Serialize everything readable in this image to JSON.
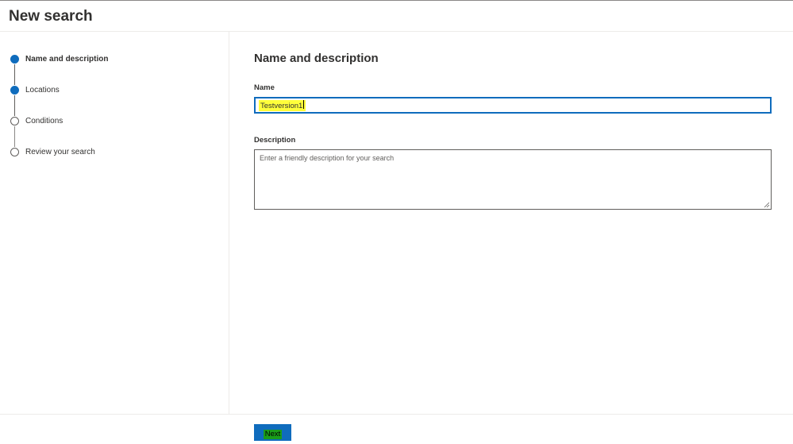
{
  "header": {
    "title": "New search"
  },
  "wizard": {
    "steps": [
      {
        "label": "Name and description",
        "state": "current"
      },
      {
        "label": "Locations",
        "state": "completed"
      },
      {
        "label": "Conditions",
        "state": "pending"
      },
      {
        "label": "Review your search",
        "state": "pending"
      }
    ]
  },
  "main": {
    "section_title": "Name and description",
    "name_label": "Name",
    "name_value": "Testversion1",
    "description_label": "Description",
    "description_placeholder": "Enter a friendly description for your search",
    "description_value": ""
  },
  "footer": {
    "next_label": "Next"
  },
  "colors": {
    "accent": "#0f6cbd",
    "text_highlight": "#ffff3b",
    "button_label_highlight": "#1a9d1a"
  }
}
